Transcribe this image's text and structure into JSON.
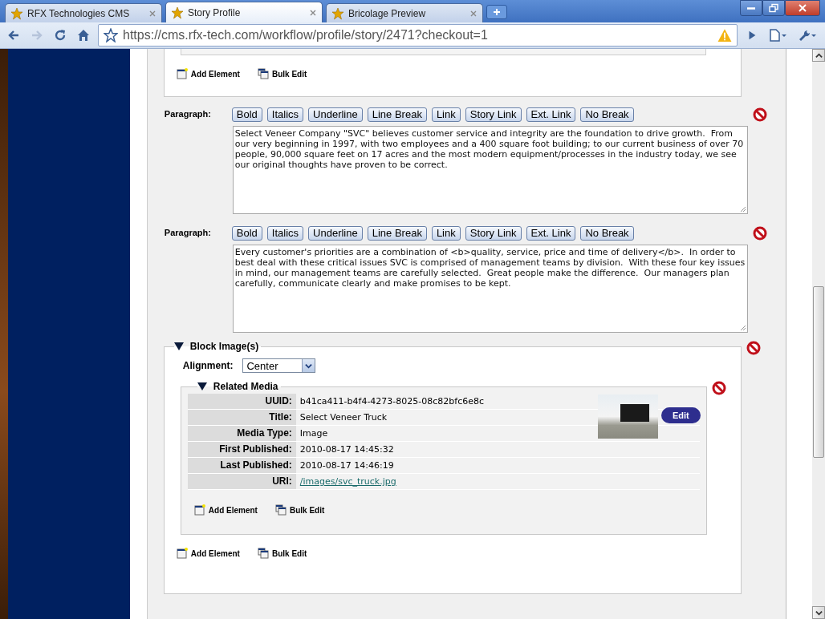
{
  "tabs": [
    {
      "title": "RFX Technologies CMS",
      "selected": false
    },
    {
      "title": "Story Profile",
      "selected": true
    },
    {
      "title": "Bricolage Preview",
      "selected": false
    }
  ],
  "address_bar": {
    "url": "https://cms.rfx-tech.com/workflow/profile/story/2471?checkout=1"
  },
  "toolbar": {
    "forward_disabled": true
  },
  "top_card": {
    "actions": [
      "Add Element",
      "Bulk Edit"
    ]
  },
  "paragraphs": [
    {
      "label": "Paragraph:",
      "buttons": [
        "Bold",
        "Italics",
        "Underline",
        "Line Break",
        "Link",
        "Story Link",
        "Ext. Link",
        "No Break"
      ],
      "text": "Select Veneer Company \"SVC\" believes customer service and integrity are the foundation to drive growth.  From our very beginning in 1997, with two employees and a 400 square foot building; to our current business of over 70 people, 90,000 square feet on 17 acres and the most modern equipment/processes in the industry today, we see our original thoughts have proven to be correct."
    },
    {
      "label": "Paragraph:",
      "buttons": [
        "Bold",
        "Italics",
        "Underline",
        "Line Break",
        "Link",
        "Story Link",
        "Ext. Link",
        "No Break"
      ],
      "text": "Every customer's priorities are a combination of <b>quality, service, price and time of delivery</b>.  In order to best deal with these critical issues SVC is comprised of management teams by division.  With these four key issues in mind, our management teams are carefully selected.  Great people make the difference.  Our managers plan carefully, communicate clearly and make promises to be kept."
    }
  ],
  "block_image": {
    "title": "Block Image(s)",
    "expanded": true,
    "alignment_label": "Alignment:",
    "alignment_value": "Center",
    "related_media": {
      "title": "Related Media",
      "expanded": true,
      "fields": [
        {
          "label": "UUID:",
          "value": "b41ca411-b4f4-4273-8025-08c82bfc6e8c",
          "kind": "text"
        },
        {
          "label": "Title:",
          "value": "Select Veneer Truck",
          "kind": "text"
        },
        {
          "label": "Media Type:",
          "value": "Image",
          "kind": "text"
        },
        {
          "label": "First Published:",
          "value": "2010-08-17 14:45:32",
          "kind": "text"
        },
        {
          "label": "Last Published:",
          "value": "2010-08-17 14:46:19",
          "kind": "text"
        },
        {
          "label": "URI:",
          "value": "/images/svc_truck.jpg",
          "kind": "link"
        }
      ],
      "edit_button": "Edit",
      "actions": [
        "Add Element",
        "Bulk Edit"
      ]
    },
    "actions": [
      "Add Element",
      "Bulk Edit"
    ]
  }
}
